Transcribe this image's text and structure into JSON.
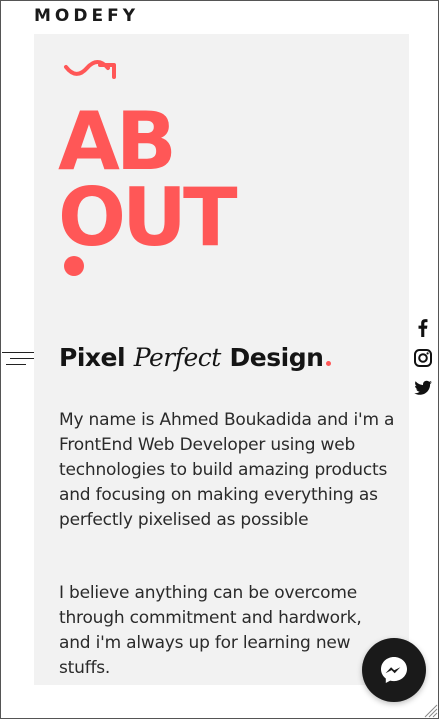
{
  "brand": {
    "name": "MODEFY"
  },
  "hero": {
    "title_line1": "AB",
    "title_line2": "OUT"
  },
  "subtitle": {
    "word1": "Pixel",
    "word2": "Perfect",
    "word3": "Design"
  },
  "about": {
    "paragraph1": "My name is Ahmed Boukadida and i'm a FrontEnd Web Developer using web technologies to build amazing products and focusing on making everything as perfectly pixelised as possible",
    "paragraph2": "I believe anything can be overcome through commitment and hardwork, and i'm always up for learning new stuffs."
  },
  "social": [
    "facebook-icon",
    "instagram-icon",
    "twitter-icon"
  ],
  "colors": {
    "accent": "#ff5757",
    "card": "#f2f2f2",
    "text": "#1e1e1e",
    "messenger_bg": "#1a1a1a"
  }
}
